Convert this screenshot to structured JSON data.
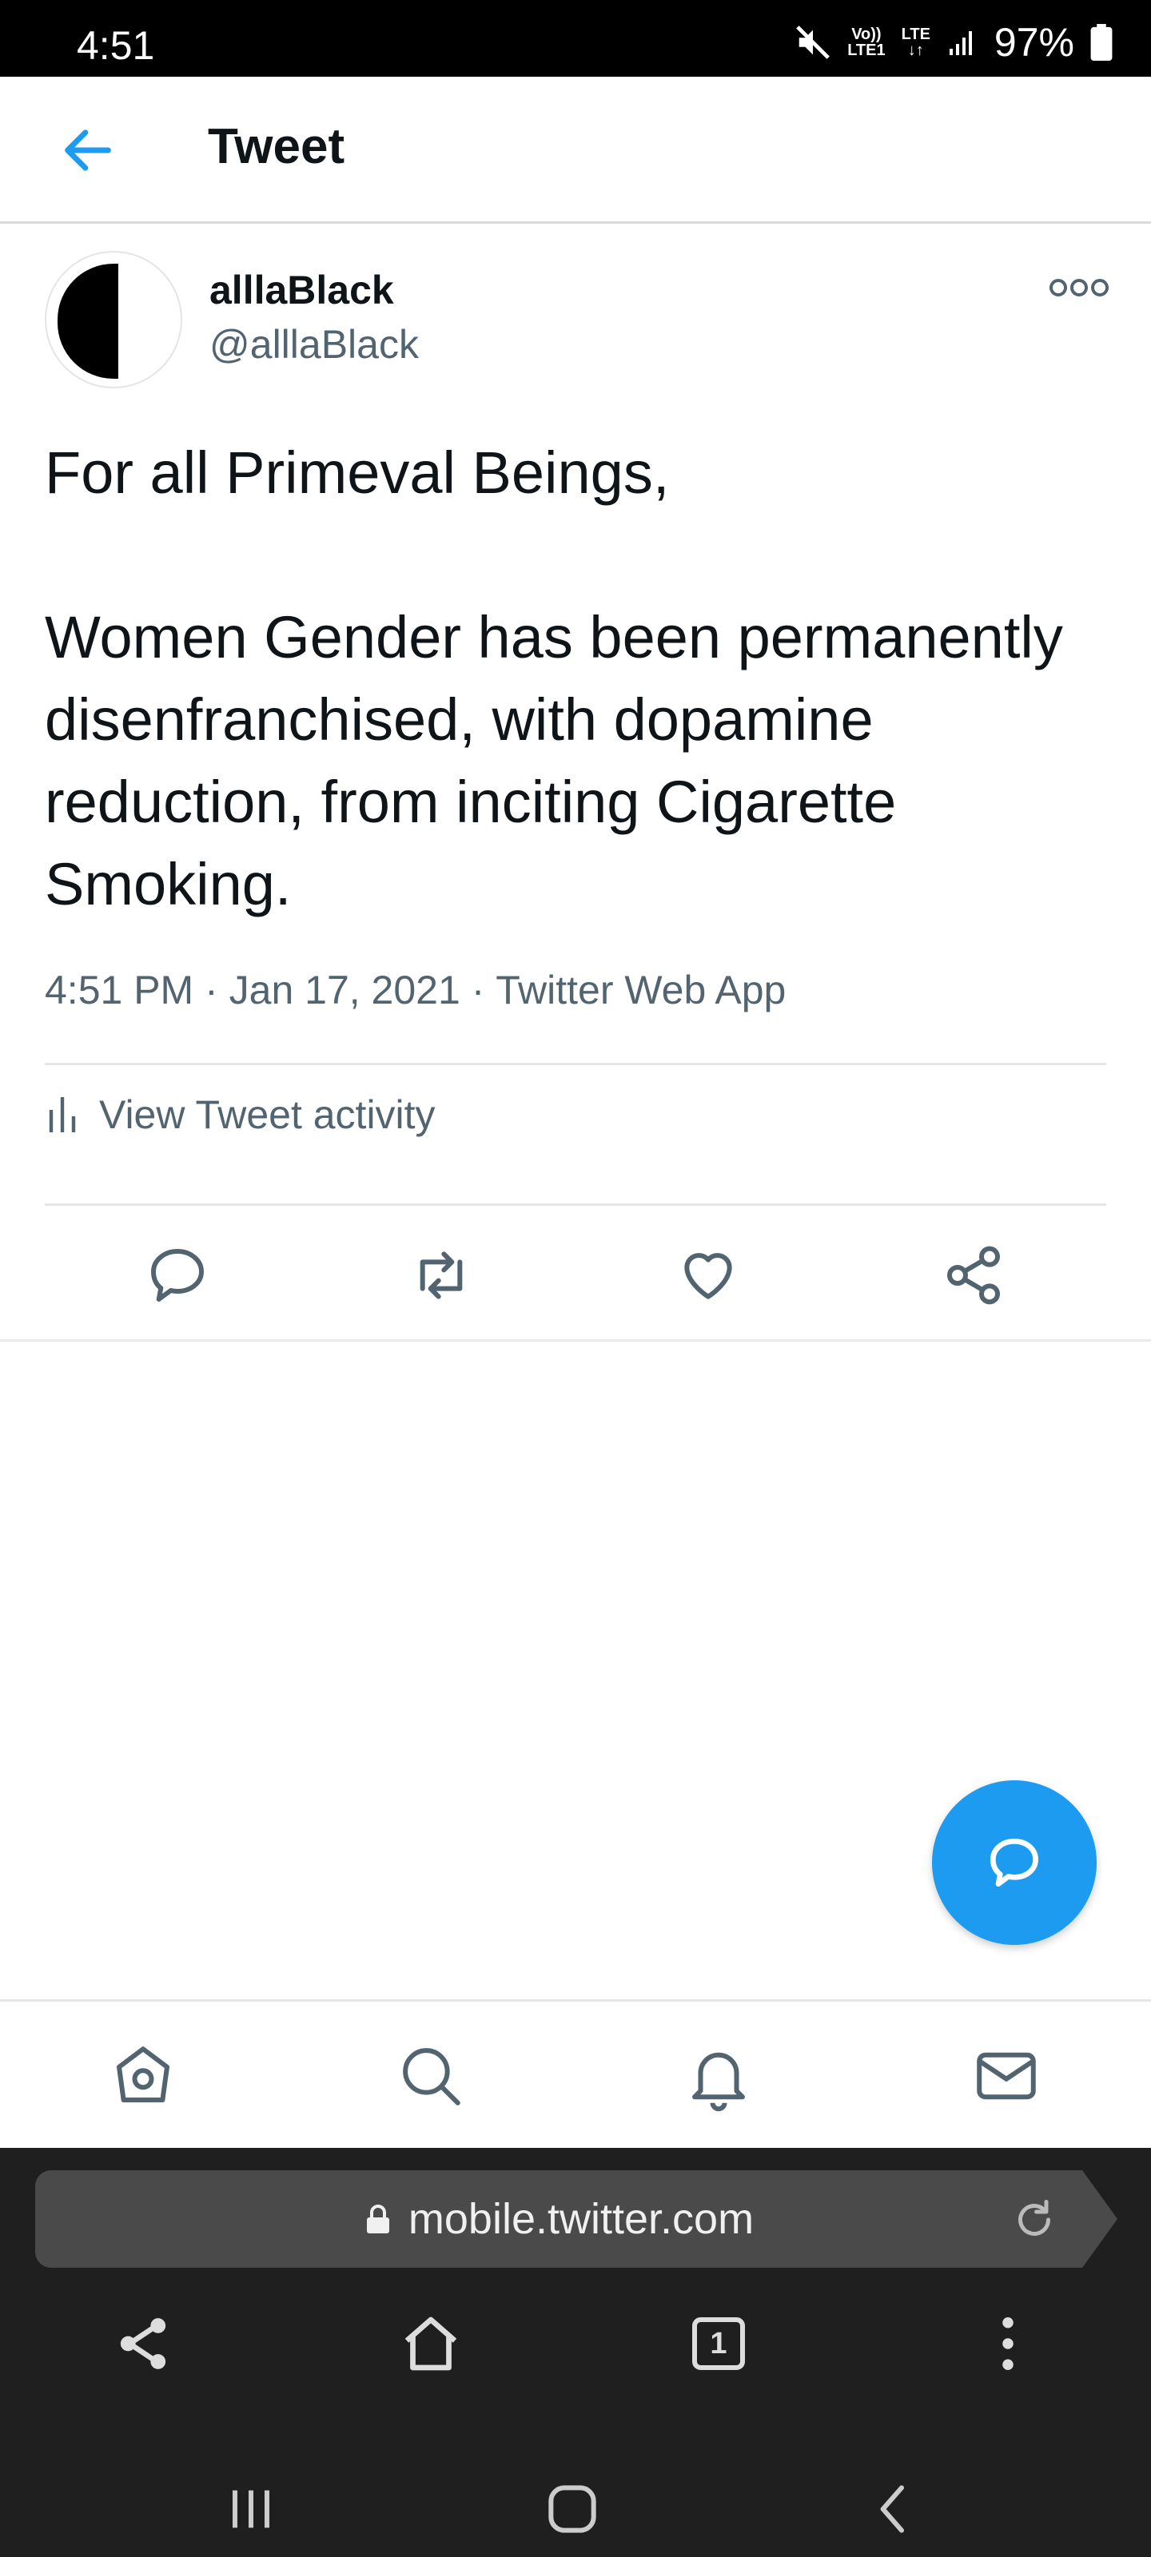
{
  "status_bar": {
    "time": "4:51",
    "signal_top": "Vo))",
    "signal_bottom": "LTE1",
    "lte": "LTE",
    "battery": "97%"
  },
  "header": {
    "title": "Tweet"
  },
  "tweet": {
    "author_name": "alllaBlack",
    "author_handle": "@alllaBlack",
    "text_line1": "For all Primeval Beings,",
    "text_para2": "Women Gender has been permanently disenfranchised, with dopamine reduction, from inciting Cigarette Smoking.",
    "time": "4:51 PM",
    "sep1": " · ",
    "date": "Jan 17, 2021",
    "sep2": " · ",
    "source": "Twitter Web App",
    "activity_label": "View Tweet activity"
  },
  "browser": {
    "url": "mobile.twitter.com",
    "tab_count": "1"
  },
  "colors": {
    "accent": "#1d9bf0",
    "muted": "#536471",
    "text": "#0f1419"
  }
}
